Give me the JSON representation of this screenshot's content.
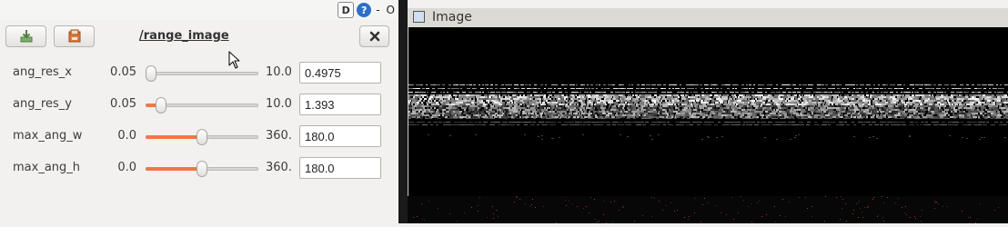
{
  "toolbar": {
    "d_label": "D",
    "help_label": "?",
    "minimize_label": "-",
    "restore_label": "O"
  },
  "panel": {
    "topic": "/range_image",
    "params": [
      {
        "name": "ang_res_x",
        "min": "0.05",
        "max": "10.0",
        "value": "0.4975",
        "fraction": 0.045
      },
      {
        "name": "ang_res_y",
        "min": "0.05",
        "max": "10.0",
        "value": "1.393",
        "fraction": 0.135
      },
      {
        "name": "max_ang_w",
        "min": "0.0",
        "max": "360.",
        "value": "180.0",
        "fraction": 0.5
      },
      {
        "name": "max_ang_h",
        "min": "0.0",
        "max": "360.",
        "value": "180.0",
        "fraction": 0.5
      }
    ]
  },
  "image_window": {
    "title": "Image"
  },
  "icons": {
    "load": "load-icon",
    "save": "save-icon",
    "close": "close-icon",
    "window": "image-window-icon",
    "cursor": "mouse-cursor-icon"
  },
  "colors": {
    "slider_accent": "#f07746",
    "background": "#f2f1f0",
    "image_bg": "#000000"
  }
}
